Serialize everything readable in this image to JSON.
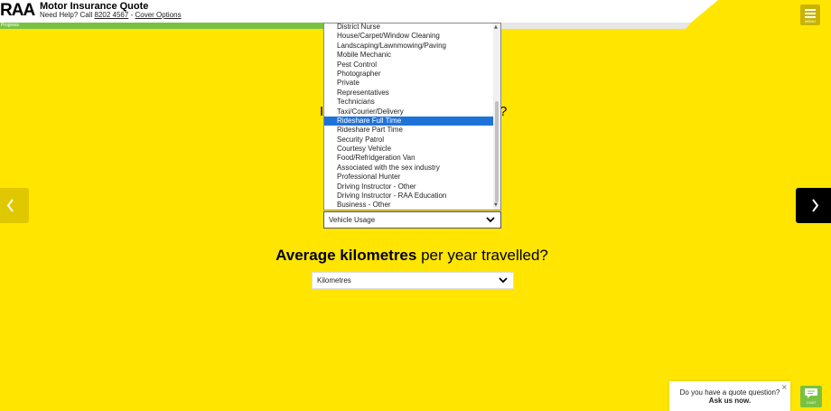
{
  "header": {
    "logo": "RAA",
    "title": "Motor Insurance Quote",
    "help_prefix": "Need Help? Call",
    "phone": "8202 4567",
    "separator": "-",
    "cover_options": "Cover Options",
    "progress_label": "Progress",
    "menu_label": "MENU"
  },
  "questions": {
    "q1_left_fragment": "I",
    "q1_right_fragment": "?",
    "q2_bold": "Average kilometres",
    "q2_rest": " per year travelled?"
  },
  "usage_list": {
    "items": [
      "District Nurse",
      "House/Carpet/Window Cleaning",
      "Landscaping/Lawnmowing/Paving",
      "Mobile Mechanic",
      "Pest Control",
      "Photographer",
      "Private",
      "Representatives",
      "Technicians",
      "Taxi/Courier/Delivery",
      "Rideshare Full Time",
      "Rideshare Part Time",
      "Security Patrol",
      "Courtesy Vehicle",
      "Food/Refridgeration Van",
      "Associated with the sex industry",
      "Professional Hunter",
      "Driving Instructor - Other",
      "Driving Instructor - RAA Education",
      "Business - Other"
    ],
    "highlighted": "Rideshare Full Time"
  },
  "selects": {
    "vehicle_usage": "Vehicle Usage",
    "kilometres": "Kilometres"
  },
  "chat": {
    "question": "Do you have a quote question?",
    "cta": "Ask us now.",
    "close": "×",
    "button_label": "CHAT"
  },
  "colors": {
    "background": "#ffe500",
    "progress": "#7ac143",
    "highlight": "#1e73d8"
  },
  "icons": {
    "prev": "chevron-left-icon",
    "next": "chevron-right-icon",
    "menu": "hamburger-icon",
    "chat": "chat-bubble-icon"
  }
}
